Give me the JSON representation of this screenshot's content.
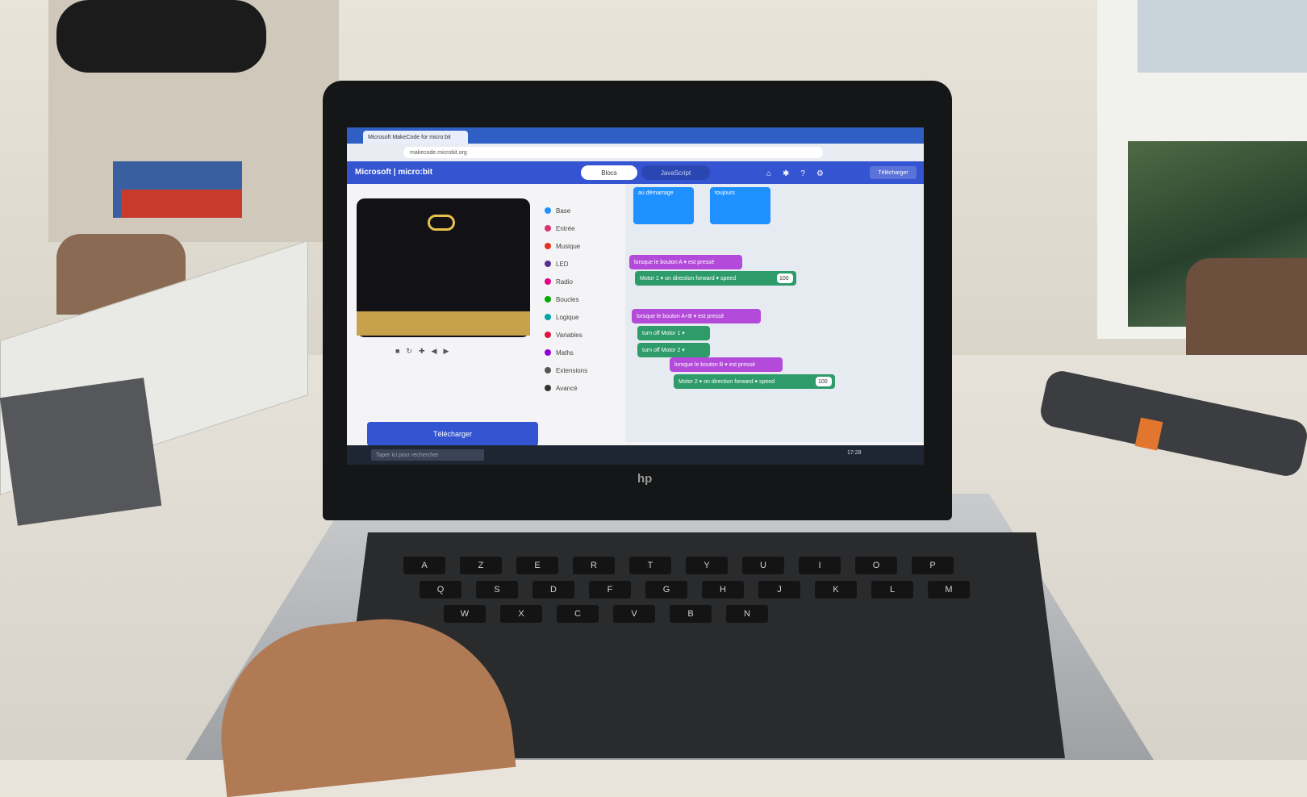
{
  "browser": {
    "tab_title": "Microsoft MakeCode for micro:bit",
    "url": "makecode.microbit.org"
  },
  "makecode": {
    "brand_microsoft": "Microsoft",
    "brand_microbit": "micro:bit",
    "mode_blocks": "Blocs",
    "mode_javascript": "JavaScript",
    "save_label": "Télécharger",
    "download_label": "Télécharger",
    "header_icons": [
      "home-icon",
      "share-icon",
      "help-icon",
      "settings-icon"
    ],
    "categories": [
      {
        "label": "Base",
        "color": "#1e90ff"
      },
      {
        "label": "Entrée",
        "color": "#d6336c"
      },
      {
        "label": "Musique",
        "color": "#e63022"
      },
      {
        "label": "LED",
        "color": "#5c2d91"
      },
      {
        "label": "Radio",
        "color": "#e3008c"
      },
      {
        "label": "Boucles",
        "color": "#00aa00"
      },
      {
        "label": "Logique",
        "color": "#00a4a6"
      },
      {
        "label": "Variables",
        "color": "#dc143c"
      },
      {
        "label": "Maths",
        "color": "#9400d3"
      },
      {
        "label": "Extensions",
        "color": "#555555"
      },
      {
        "label": "Avancé",
        "color": "#333333"
      }
    ],
    "blocks": {
      "on_start": "au démarrage",
      "forever": "toujours",
      "on_button_a": "lorsque le bouton A ▾ est pressé",
      "motor_forward": "Motor 1 ▾ on direction forward ▾ speed",
      "motor_speed": "100",
      "on_button_ab": "lorsque le bouton A+B ▾ est pressé",
      "turn_off_motor_1": "turn off Motor 1 ▾",
      "turn_off_motor_2": "turn off Motor 2 ▾",
      "on_button_b": "lorsque le bouton B ▾ est pressé",
      "motor_forward_2": "Motor 2 ▾ on direction forward ▾ speed",
      "motor_speed_2": "100"
    }
  },
  "taskbar": {
    "search_placeholder": "Taper ici pour rechercher",
    "clock": "17:28"
  },
  "laptop": {
    "logo": "hp"
  },
  "keyboard": {
    "row1": [
      "A",
      "Z",
      "E",
      "R",
      "T",
      "Y",
      "U",
      "I",
      "O",
      "P"
    ],
    "row2": [
      "Q",
      "S",
      "D",
      "F",
      "G",
      "H",
      "J",
      "K",
      "L",
      "M"
    ],
    "row3": [
      "W",
      "X",
      "C",
      "V",
      "B",
      "N"
    ]
  }
}
